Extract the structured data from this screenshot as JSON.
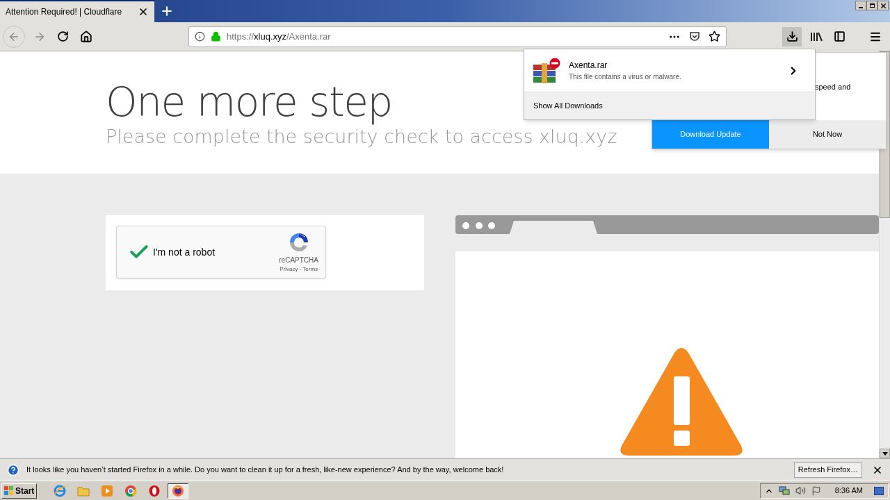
{
  "tab": {
    "title": "Attention Required! | Cloudflare",
    "selected": true
  },
  "url": {
    "scheme": "https://",
    "host": "xluq.xyz",
    "path": "/Axenta.rar",
    "secure": true
  },
  "downloads_button": {
    "selected": true
  },
  "page": {
    "heading": "One more step",
    "subheading": "Please complete the security check to access xluq.xyz"
  },
  "captcha": {
    "label": "I'm not a robot",
    "checked": true,
    "brand": "reCAPTCHA",
    "links": "Privacy - Terms"
  },
  "downloads_panel": {
    "items": [
      {
        "name": "Axenta.rar",
        "status": "This file contains a virus or malware.",
        "blocked": true
      }
    ],
    "footer": "Show All Downloads"
  },
  "update_prompt": {
    "text": "speed and",
    "buttons": [
      {
        "label": "Download Update",
        "primary": true
      },
      {
        "label": "Not Now",
        "primary": false
      }
    ]
  },
  "notification": {
    "message": "It looks like you haven’t started Firefox in a while. Do you want to clean it up for a fresh, like-new experience? And by the way, welcome back!",
    "button": "Refresh Firefox…"
  },
  "taskbar": {
    "start": "Start",
    "apps": [
      {
        "kind": "ie",
        "selected": false
      },
      {
        "kind": "folder",
        "selected": false
      },
      {
        "kind": "media",
        "selected": false
      },
      {
        "kind": "chrome",
        "selected": false
      },
      {
        "kind": "opera",
        "selected": false
      },
      {
        "kind": "firefox",
        "selected": true
      }
    ],
    "clock": "8:36 AM"
  }
}
